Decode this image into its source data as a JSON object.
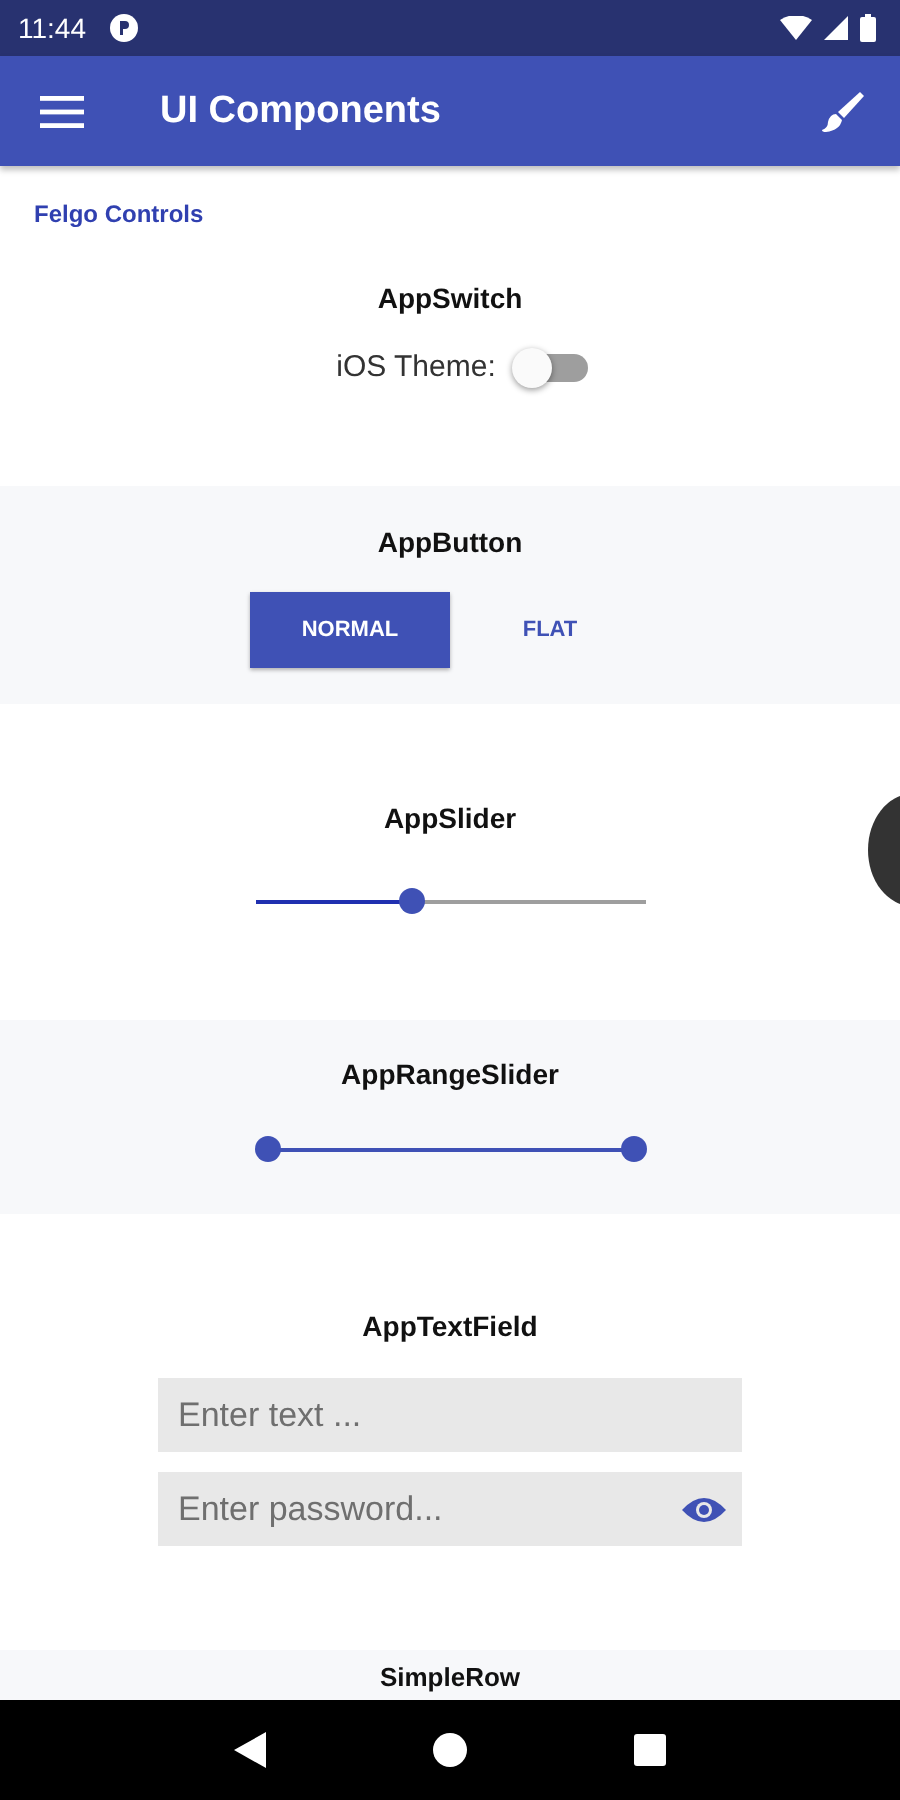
{
  "status_bar": {
    "time": "11:44"
  },
  "app_bar": {
    "title": "UI Components"
  },
  "section_header": "Felgo Controls",
  "sections": [
    {
      "kind": "switch",
      "title": "AppSwitch",
      "label": "iOS Theme:",
      "on": false
    },
    {
      "kind": "buttons",
      "title": "AppButton",
      "buttons": [
        {
          "label": "NORMAL",
          "kind": "raised"
        },
        {
          "label": "FLAT",
          "kind": "flat"
        }
      ]
    },
    {
      "kind": "slider",
      "title": "AppSlider",
      "level": 0.4
    },
    {
      "kind": "range",
      "title": "AppRangeSlider",
      "thumbs": [
        {
          "level": 0
        },
        {
          "level": 1
        }
      ]
    },
    {
      "kind": "fields",
      "title": "AppTextField",
      "fields": [
        {
          "placeholder": "Enter text ...",
          "kind": "text"
        },
        {
          "placeholder": "Enter password...",
          "kind": "password"
        }
      ]
    },
    {
      "kind": "row",
      "title": "SimpleRow"
    }
  ]
}
